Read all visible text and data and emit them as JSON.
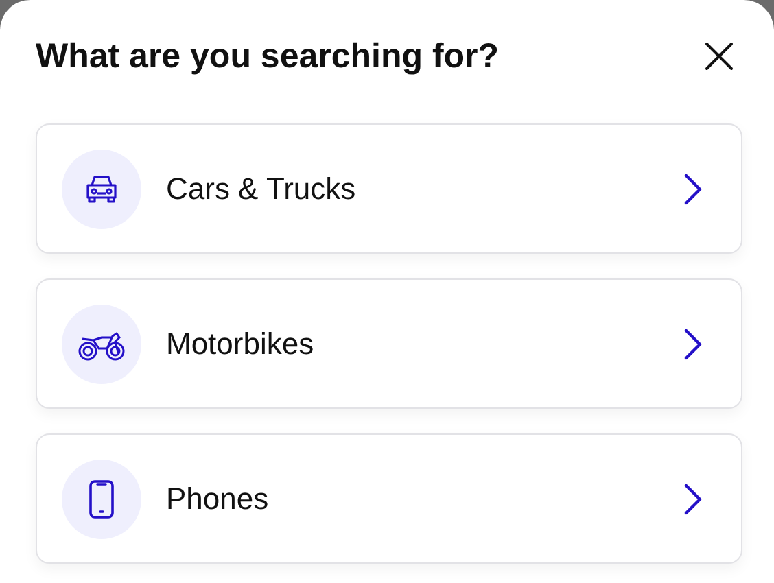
{
  "title": "What are you searching for?",
  "options": [
    {
      "kind": "car",
      "label": "Cars & Trucks"
    },
    {
      "kind": "motorbike",
      "label": "Motorbikes"
    },
    {
      "kind": "phone",
      "label": "Phones"
    }
  ]
}
